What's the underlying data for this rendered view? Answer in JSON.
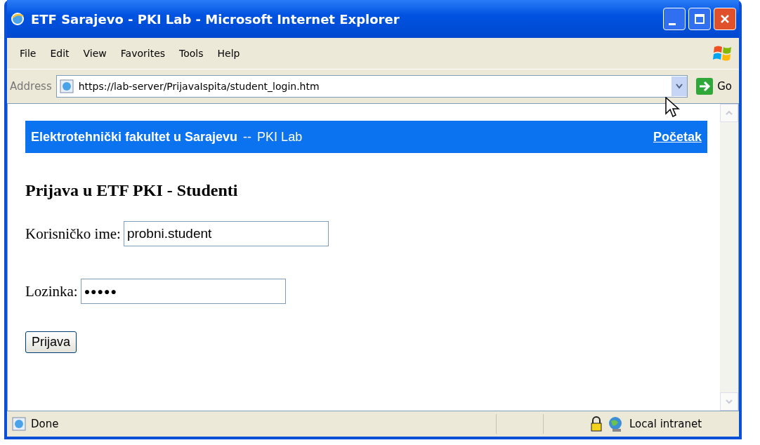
{
  "window": {
    "title": "ETF Sarajevo - PKI Lab - Microsoft Internet Explorer"
  },
  "menu": [
    "File",
    "Edit",
    "View",
    "Favorites",
    "Tools",
    "Help"
  ],
  "address_bar": {
    "label": "Address",
    "url": "https://lab-server/PrijavaIspita/student_login.htm",
    "go": "Go"
  },
  "page": {
    "banner": {
      "school": "Elektrotehnički fakultet u Sarajevu",
      "separator": "--",
      "lab": "PKI Lab",
      "home_link": "Početak"
    },
    "heading": "Prijava u ETF PKI - Studenti",
    "fields": [
      {
        "kind": "text",
        "label": "Korisničko ime:",
        "value": "probni.student"
      },
      {
        "kind": "password",
        "label": "Lozinka:",
        "value": "●●●●●"
      }
    ],
    "submit": "Prijava"
  },
  "status_bar": {
    "text": "Done",
    "zone": "Local intranet"
  }
}
